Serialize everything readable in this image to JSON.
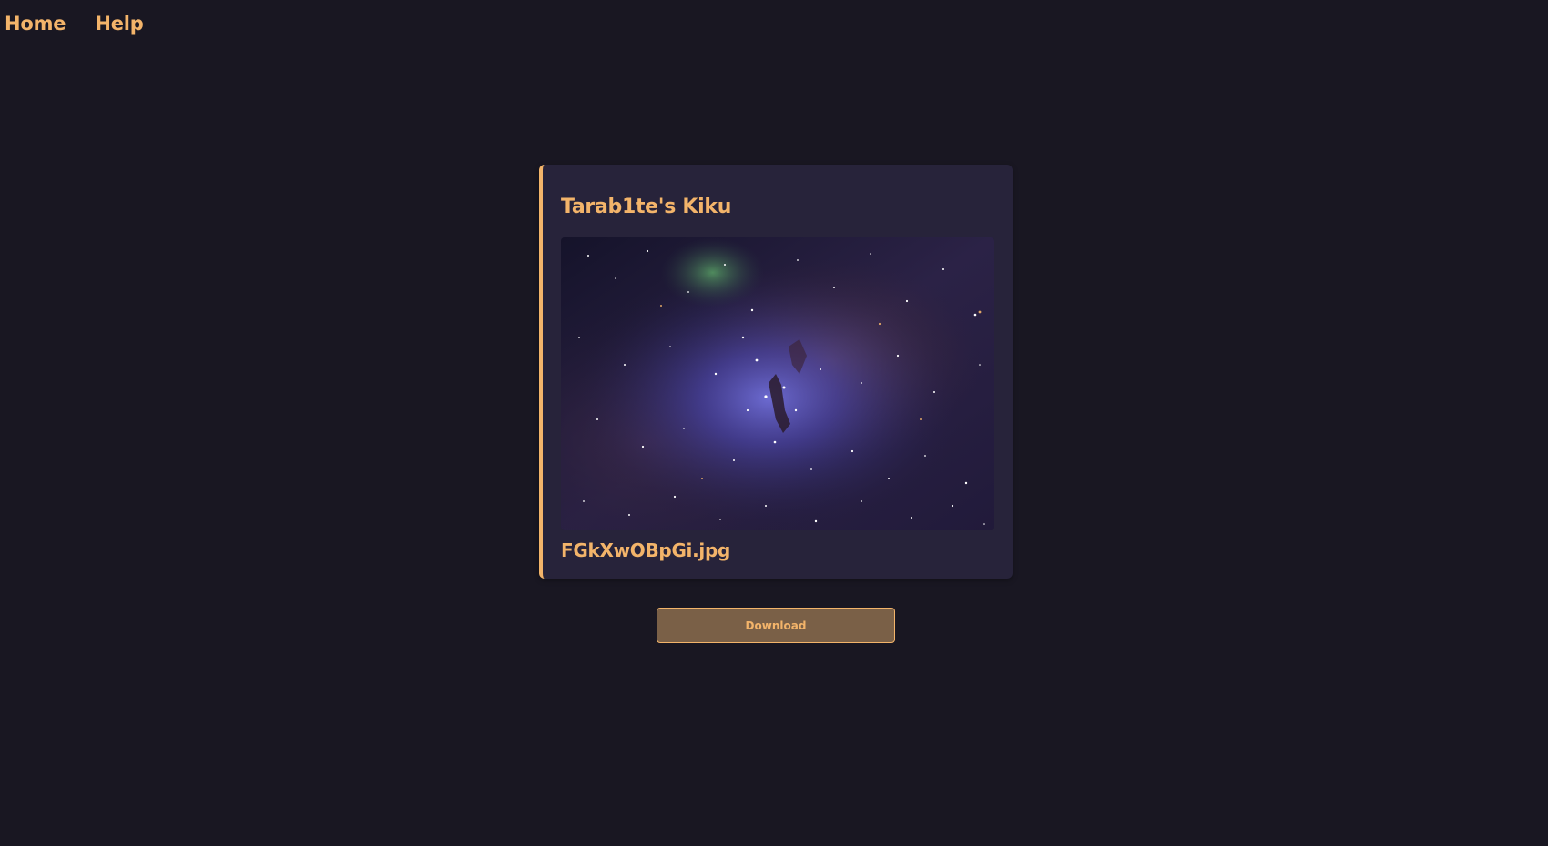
{
  "nav": {
    "home_label": "Home",
    "help_label": "Help"
  },
  "card": {
    "title": "Tarab1te's Kiku",
    "filename": "FGkXwOBpGi.jpg",
    "accent_color": "#f3b46a"
  },
  "actions": {
    "download_label": "Download"
  },
  "colors": {
    "background": "#191722",
    "card_background": "#27233a",
    "accent": "#f3b46a",
    "button_background": "#7a6047"
  }
}
